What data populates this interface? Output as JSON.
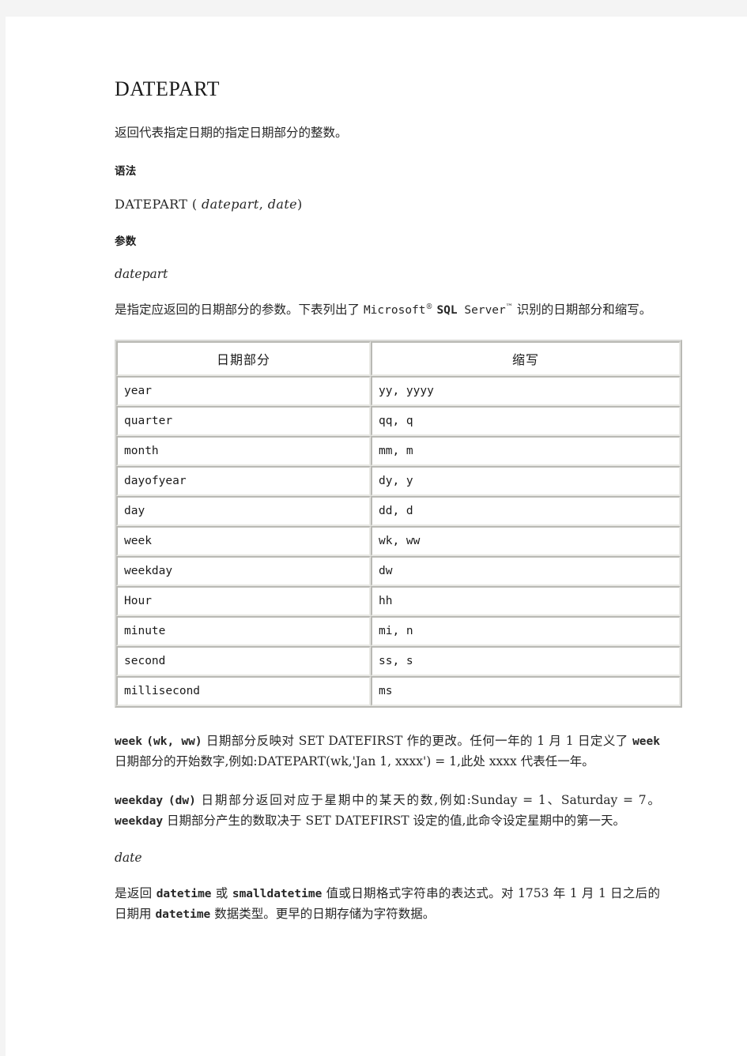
{
  "document": {
    "title": "DATEPART",
    "intro": "返回代表指定日期的指定日期部分的整数。",
    "syntax_heading": "语法",
    "syntax": {
      "fn": "DATEPART",
      "open": "(",
      "arg1": "datepart",
      "comma": ",",
      "arg2": "date",
      "close": ")"
    },
    "arguments_heading": "参数",
    "param_datepart": {
      "name": "datepart",
      "desc_before": "是指定应返回的日期部分的参数。下表列出了 ",
      "vendor": "Microsoft",
      "vendor_mark": "®",
      "product_bold": "SQL",
      "product_rest": " Server",
      "product_mark": "™",
      "desc_after": " 识别的日期部分和缩写。"
    },
    "table": {
      "headers": [
        "日期部分",
        "缩写"
      ],
      "rows": [
        {
          "part": "year",
          "abbr": "yy, yyyy"
        },
        {
          "part": "quarter",
          "abbr": "qq, q"
        },
        {
          "part": "month",
          "abbr": "mm, m"
        },
        {
          "part": "dayofyear",
          "abbr": "dy, y"
        },
        {
          "part": "day",
          "abbr": "dd, d"
        },
        {
          "part": "week",
          "abbr": "wk, ww"
        },
        {
          "part": "weekday",
          "abbr": "dw"
        },
        {
          "part": "Hour",
          "abbr": "hh"
        },
        {
          "part": "minute",
          "abbr": "mi, n"
        },
        {
          "part": "second",
          "abbr": "ss, s"
        },
        {
          "part": "millisecond",
          "abbr": "ms"
        }
      ]
    },
    "note_week": {
      "term": "week",
      "abbr": "(wk, ww)",
      "text_1": " 日期部分反映对 SET DATEFIRST 作的更改。任何一年的 1 月 1 日定义了 ",
      "term_2": "week",
      "text_2": " 日期部分的开始数字,例如:DATEPART(wk,'Jan 1, xxxx') = 1,此处 xxxx 代表任一年。"
    },
    "note_weekday": {
      "term": "weekday",
      "abbr": "(dw)",
      "text_1": " 日期部分返回对应于星期中的某天的数,例如:Sunday = 1、Saturday = 7。",
      "term_2": "weekday",
      "text_2": " 日期部分产生的数取决于 SET DATEFIRST 设定的值,此命令设定星期中的第一天。"
    },
    "param_date": {
      "name": "date",
      "text_1": "是返回 ",
      "type_1": "datetime",
      "text_2": " 或 ",
      "type_2": "smalldatetime",
      "text_3": " 值或日期格式字符串的表达式。对 1753 年 1 月 1 日之后的日期用 ",
      "type_3": "datetime",
      "text_4": " 数据类型。更早的日期存储为字符数据。"
    }
  }
}
